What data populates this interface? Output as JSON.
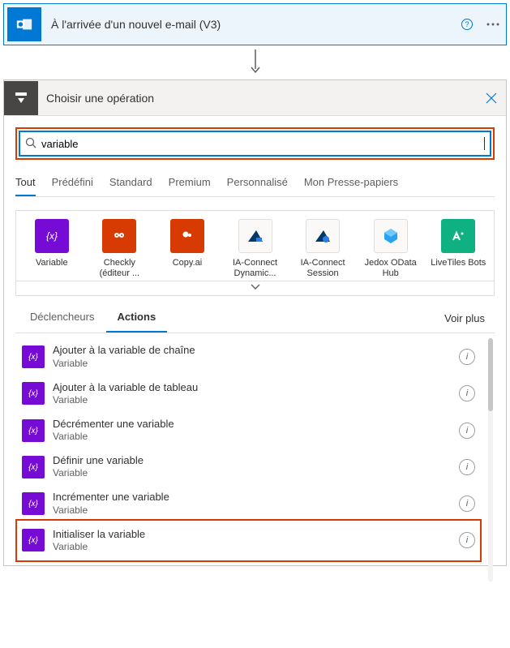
{
  "trigger": {
    "title": "À l'arrivée d'un nouvel e-mail (V3)"
  },
  "operation": {
    "header_title": "Choisir une opération",
    "search_value": "variable",
    "filters": {
      "tout": "Tout",
      "predefini": "Prédéfini",
      "standard": "Standard",
      "premium": "Premium",
      "personnalise": "Personnalisé",
      "presse": "Mon Presse-papiers"
    },
    "connectors": {
      "variable": "Variable",
      "checkly": "Checkly (éditeur ...",
      "copyai": "Copy.ai",
      "iac_dynamic": "IA-Connect Dynamic...",
      "iac_session": "IA-Connect Session",
      "jedox": "Jedox OData Hub",
      "livetiles": "LiveTiles Bots"
    },
    "subtabs": {
      "declencheurs": "Déclencheurs",
      "actions": "Actions",
      "voir_plus": "Voir plus"
    },
    "actions": [
      {
        "name": "Ajouter à la variable de chaîne",
        "sub": "Variable"
      },
      {
        "name": "Ajouter à la variable de tableau",
        "sub": "Variable"
      },
      {
        "name": "Décrémenter une variable",
        "sub": "Variable"
      },
      {
        "name": "Définir une variable",
        "sub": "Variable"
      },
      {
        "name": "Incrémenter une variable",
        "sub": "Variable"
      },
      {
        "name": "Initialiser la variable",
        "sub": "Variable"
      }
    ]
  }
}
